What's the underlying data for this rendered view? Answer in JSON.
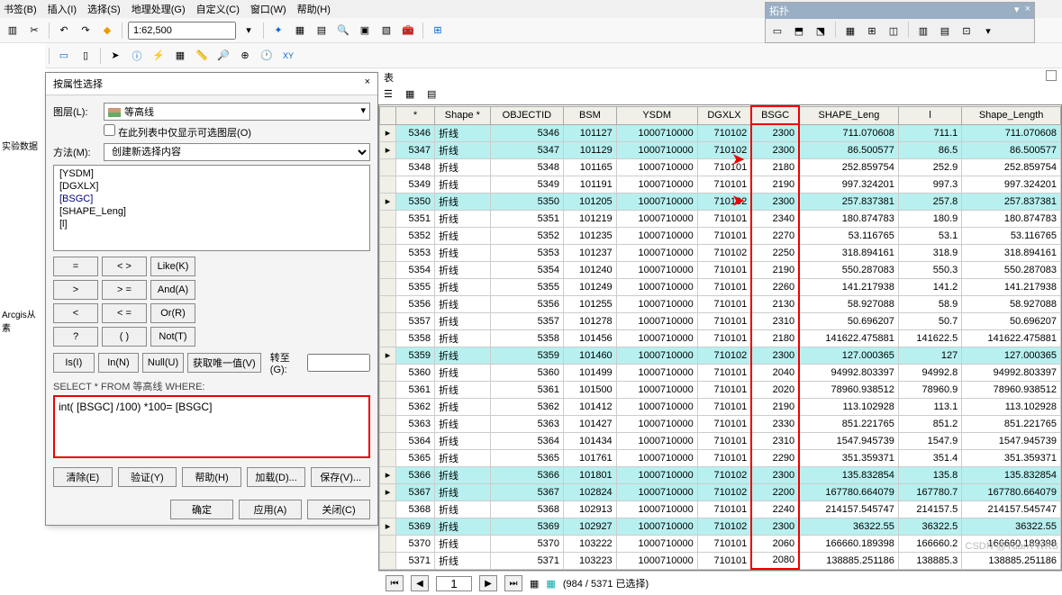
{
  "menus": [
    "书签(B)",
    "插入(I)",
    "选择(S)",
    "地理处理(G)",
    "自定义(C)",
    "窗口(W)",
    "帮助(H)"
  ],
  "scale": "1:62,500",
  "topo": {
    "title": "拓扑",
    "close": "×"
  },
  "left_labels": [
    "实验数据",
    "Arcgis从素"
  ],
  "dialog": {
    "title": "按属性选择",
    "layer_label": "图层(L):",
    "layer_value": "等高线",
    "only_sel": "在此列表中仅显示可选图层(O)",
    "method_label": "方法(M):",
    "method_value": "创建新选择内容",
    "fields": [
      "[YSDM]",
      "[DGXLX]",
      "[BSGC]",
      "[SHAPE_Leng]",
      "[l]"
    ],
    "ops": {
      "eq": "=",
      "ne": "< >",
      "like": "Like(K)",
      "gt": ">",
      "ge": "> =",
      "and": "And(A)",
      "lt": "<",
      "le": "< =",
      "or": "Or(R)",
      "pct": "?",
      "paren": "( )",
      "not": "Not(T)",
      "isf": "Is(I)",
      "inf": "In(N)",
      "null": "Null(U)",
      "uv": "获取唯一值(V)",
      "go": "转至(G):"
    },
    "sql_label": "SELECT * FROM 等高线 WHERE:",
    "sql": "int( [BSGC] /100) *100= [BSGC]",
    "btns": {
      "clear": "清除(E)",
      "verify": "验证(Y)",
      "help": "帮助(H)",
      "load": "加载(D)...",
      "save": "保存(V)..."
    },
    "bottom": {
      "ok": "确定",
      "apply": "应用(A)",
      "close": "关闭(C)"
    }
  },
  "table": {
    "title": "表",
    "columns": [
      "",
      "*",
      "Shape *",
      "OBJECTID",
      "BSM",
      "YSDM",
      "DGXLX",
      "BSGC",
      "SHAPE_Leng",
      "l",
      "Shape_Length"
    ],
    "hl_col": 7,
    "rows": [
      {
        "sel": true,
        "c": [
          5346,
          "折线",
          5346,
          101127,
          "1000710000",
          710102,
          2300,
          "711.070608",
          "711.1",
          "711.070608"
        ]
      },
      {
        "sel": true,
        "c": [
          5347,
          "折线",
          5347,
          101129,
          "1000710000",
          710102,
          2300,
          "86.500577",
          "86.5",
          "86.500577"
        ]
      },
      {
        "sel": false,
        "c": [
          5348,
          "折线",
          5348,
          101165,
          "1000710000",
          710101,
          2180,
          "252.859754",
          "252.9",
          "252.859754"
        ]
      },
      {
        "sel": false,
        "c": [
          5349,
          "折线",
          5349,
          101191,
          "1000710000",
          710101,
          2190,
          "997.324201",
          "997.3",
          "997.324201"
        ]
      },
      {
        "sel": true,
        "c": [
          5350,
          "折线",
          5350,
          101205,
          "1000710000",
          710102,
          2300,
          "257.837381",
          "257.8",
          "257.837381"
        ]
      },
      {
        "sel": false,
        "c": [
          5351,
          "折线",
          5351,
          101219,
          "1000710000",
          710101,
          2340,
          "180.874783",
          "180.9",
          "180.874783"
        ]
      },
      {
        "sel": false,
        "c": [
          5352,
          "折线",
          5352,
          101235,
          "1000710000",
          710101,
          2270,
          "53.116765",
          "53.1",
          "53.116765"
        ]
      },
      {
        "sel": false,
        "c": [
          5353,
          "折线",
          5353,
          101237,
          "1000710000",
          710102,
          2250,
          "318.894161",
          "318.9",
          "318.894161"
        ]
      },
      {
        "sel": false,
        "c": [
          5354,
          "折线",
          5354,
          101240,
          "1000710000",
          710101,
          2190,
          "550.287083",
          "550.3",
          "550.287083"
        ]
      },
      {
        "sel": false,
        "c": [
          5355,
          "折线",
          5355,
          101249,
          "1000710000",
          710101,
          2260,
          "141.217938",
          "141.2",
          "141.217938"
        ]
      },
      {
        "sel": false,
        "c": [
          5356,
          "折线",
          5356,
          101255,
          "1000710000",
          710101,
          2130,
          "58.927088",
          "58.9",
          "58.927088"
        ]
      },
      {
        "sel": false,
        "c": [
          5357,
          "折线",
          5357,
          101278,
          "1000710000",
          710101,
          2310,
          "50.696207",
          "50.7",
          "50.696207"
        ]
      },
      {
        "sel": false,
        "c": [
          5358,
          "折线",
          5358,
          101456,
          "1000710000",
          710101,
          2180,
          "141622.475881",
          "141622.5",
          "141622.475881"
        ]
      },
      {
        "sel": true,
        "c": [
          5359,
          "折线",
          5359,
          101460,
          "1000710000",
          710102,
          2300,
          "127.000365",
          "127",
          "127.000365"
        ]
      },
      {
        "sel": false,
        "c": [
          5360,
          "折线",
          5360,
          101499,
          "1000710000",
          710101,
          2040,
          "94992.803397",
          "94992.8",
          "94992.803397"
        ]
      },
      {
        "sel": false,
        "c": [
          5361,
          "折线",
          5361,
          101500,
          "1000710000",
          710101,
          2020,
          "78960.938512",
          "78960.9",
          "78960.938512"
        ]
      },
      {
        "sel": false,
        "c": [
          5362,
          "折线",
          5362,
          101412,
          "1000710000",
          710101,
          2190,
          "113.102928",
          "113.1",
          "113.102928"
        ]
      },
      {
        "sel": false,
        "c": [
          5363,
          "折线",
          5363,
          101427,
          "1000710000",
          710101,
          2330,
          "851.221765",
          "851.2",
          "851.221765"
        ]
      },
      {
        "sel": false,
        "c": [
          5364,
          "折线",
          5364,
          101434,
          "1000710000",
          710101,
          2310,
          "1547.945739",
          "1547.9",
          "1547.945739"
        ]
      },
      {
        "sel": false,
        "c": [
          5365,
          "折线",
          5365,
          101761,
          "1000710000",
          710101,
          2290,
          "351.359371",
          "351.4",
          "351.359371"
        ]
      },
      {
        "sel": true,
        "c": [
          5366,
          "折线",
          5366,
          101801,
          "1000710000",
          710102,
          2300,
          "135.832854",
          "135.8",
          "135.832854"
        ]
      },
      {
        "sel": true,
        "c": [
          5367,
          "折线",
          5367,
          102824,
          "1000710000",
          710102,
          2200,
          "167780.664079",
          "167780.7",
          "167780.664079"
        ]
      },
      {
        "sel": false,
        "c": [
          5368,
          "折线",
          5368,
          102913,
          "1000710000",
          710101,
          2240,
          "214157.545747",
          "214157.5",
          "214157.545747"
        ]
      },
      {
        "sel": true,
        "c": [
          5369,
          "折线",
          5369,
          102927,
          "1000710000",
          710102,
          2300,
          "36322.55",
          "36322.5",
          "36322.55"
        ]
      },
      {
        "sel": false,
        "c": [
          5370,
          "折线",
          5370,
          103222,
          "1000710000",
          710101,
          2060,
          "166660.189398",
          "166660.2",
          "166660.189398"
        ]
      },
      {
        "sel": false,
        "c": [
          5371,
          "折线",
          5371,
          103223,
          "1000710000",
          710101,
          2080,
          "138885.251186",
          "138885.3",
          "138885.251186"
        ]
      }
    ],
    "nav": {
      "pos": "1",
      "status": "(984 / 5371 已选择)"
    }
  },
  "watermark": "CSDN @YuanYWRS"
}
